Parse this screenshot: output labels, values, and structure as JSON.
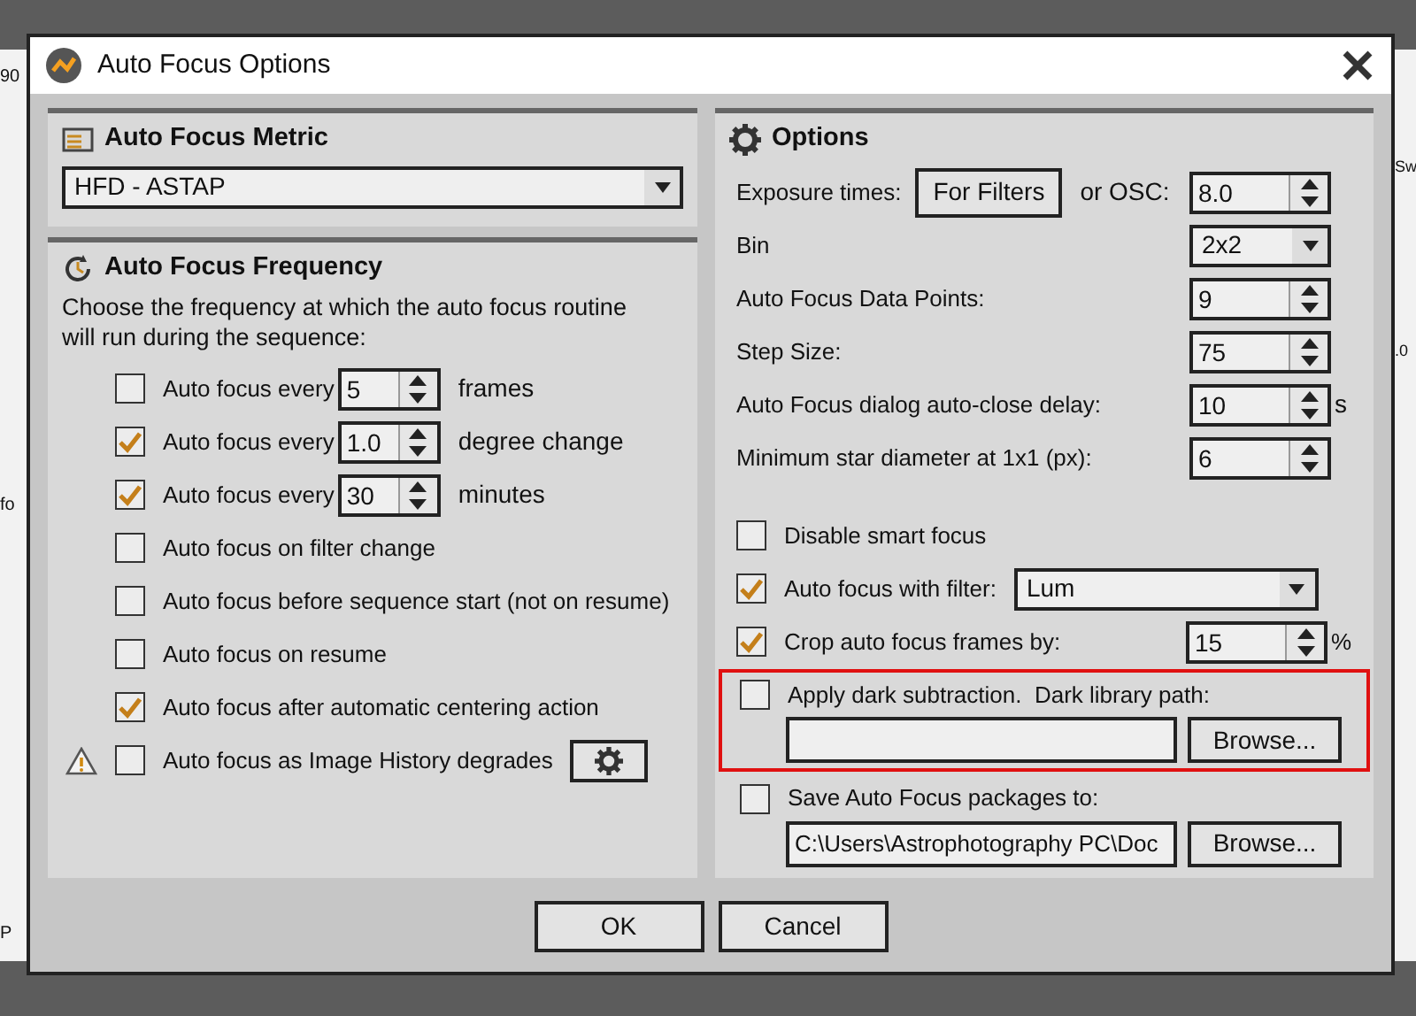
{
  "background_window": {
    "left_texts": [
      "90",
      "fo",
      "P"
    ],
    "right_texts": [
      "Sw",
      ".0"
    ]
  },
  "window": {
    "title": "Auto Focus Options"
  },
  "metric": {
    "title": "Auto Focus Metric",
    "value": "HFD - ASTAP"
  },
  "frequency": {
    "title": "Auto Focus Frequency",
    "description": "Choose the frequency at which the auto focus routine will run during the sequence:",
    "rows": [
      {
        "kind": "spin",
        "label": "Auto focus every",
        "checked": false,
        "value": "5",
        "unit": "frames"
      },
      {
        "kind": "spin",
        "label": "Auto focus every",
        "checked": true,
        "value": "1.0",
        "unit": "degree change"
      },
      {
        "kind": "spin",
        "label": "Auto focus every",
        "checked": true,
        "value": "30",
        "unit": "minutes"
      },
      {
        "kind": "check",
        "label": "Auto focus on filter change",
        "checked": false
      },
      {
        "kind": "check",
        "label": "Auto focus before sequence start (not on resume)",
        "checked": false
      },
      {
        "kind": "check",
        "label": "Auto focus on resume",
        "checked": false
      },
      {
        "kind": "check",
        "label": "Auto focus after automatic centering action",
        "checked": true
      },
      {
        "kind": "history",
        "label": "Auto focus as Image History degrades",
        "checked": false
      }
    ]
  },
  "options": {
    "title": "Options",
    "fields": [
      {
        "kind": "exposure",
        "label": "Exposure times:",
        "button": "For Filters",
        "label2": "or OSC:",
        "value": "8.0"
      },
      {
        "kind": "select",
        "label": "Bin",
        "value": "2x2"
      },
      {
        "kind": "spin",
        "label": "Auto Focus Data Points:",
        "value": "9"
      },
      {
        "kind": "spin",
        "label": "Step Size:",
        "value": "75"
      },
      {
        "kind": "spin",
        "label": "Auto Focus dialog auto-close delay:",
        "value": "10",
        "unit": "s"
      },
      {
        "kind": "spin",
        "label": "Minimum star diameter at 1x1 (px):",
        "value": "6"
      }
    ],
    "checks": [
      {
        "kind": "plain",
        "label": "Disable smart focus",
        "checked": false
      },
      {
        "kind": "select",
        "label": "Auto focus with filter:",
        "checked": true,
        "value": "Lum"
      },
      {
        "kind": "spin",
        "label": "Crop auto focus frames by:",
        "checked": true,
        "value": "15",
        "unit": "%"
      },
      {
        "kind": "path",
        "label": "Apply dark subtraction.  Dark library path:",
        "checked": false,
        "highlighted": true,
        "button": "Browse..."
      },
      {
        "kind": "path",
        "label": "Save Auto Focus packages to:",
        "checked": false,
        "path": "C:\\Users\\Astrophotography PC\\Doc",
        "button": "Browse..."
      }
    ]
  },
  "buttons": [
    "OK",
    "Cancel"
  ]
}
